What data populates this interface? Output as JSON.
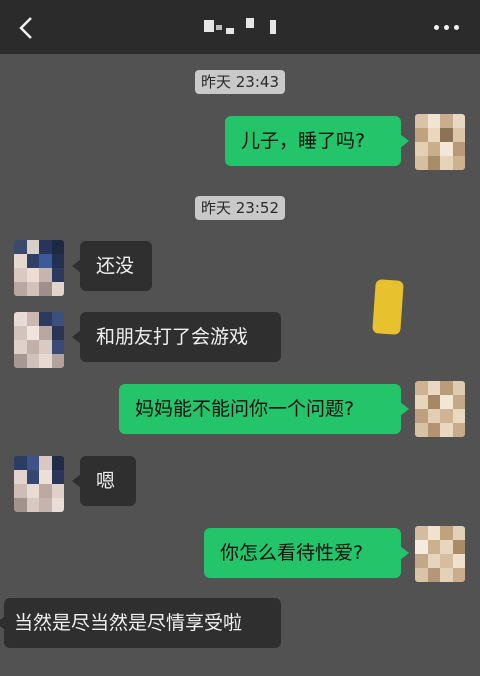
{
  "header": {
    "back_icon": "chevron-left-icon",
    "more_icon": "more-dots-icon",
    "background": "#2b2b2b"
  },
  "colors": {
    "outgoing_bubble": "#23c46a",
    "incoming_bubble": "#2f2f2f",
    "chat_background": "#525252"
  },
  "messages": [
    {
      "kind": "time",
      "text": "昨天 23:43"
    },
    {
      "kind": "out",
      "text": "儿子，睡了吗?"
    },
    {
      "kind": "time",
      "text": "昨天 23:52"
    },
    {
      "kind": "in",
      "text": "还没"
    },
    {
      "kind": "in",
      "text": "和朋友打了会游戏"
    },
    {
      "kind": "out",
      "text": "妈妈能不能问你一个问题?"
    },
    {
      "kind": "in",
      "text": "嗯"
    },
    {
      "kind": "out",
      "text": "你怎么看待性爱?"
    },
    {
      "kind": "in",
      "text": "当然是尽当然是尽情享受啦"
    }
  ]
}
